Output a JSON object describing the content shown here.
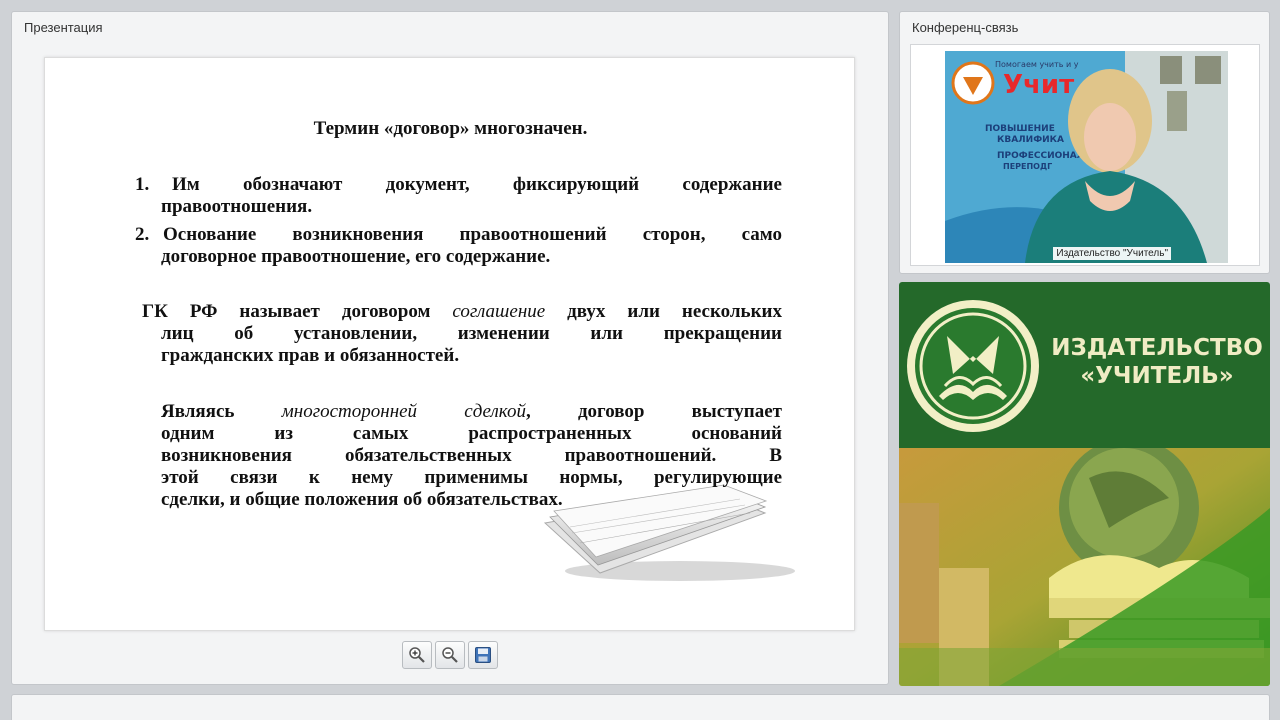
{
  "presentation": {
    "title": "Презентация",
    "slide": {
      "heading": "Термин «договор» многозначен.",
      "item1_num": "1.",
      "item1_line1": "Им обозначают документ, фиксирующий содержание",
      "item1_line2": "правоотношения.",
      "item2_num": "2.",
      "item2_line1": "Основание возникновения правоотношений сторон, само",
      "item2_line2": "договорное правоотношение, его содержание.",
      "para1_line1_a": "ГК РФ называет договором ",
      "para1_line1_em": "соглашение",
      "para1_line1_b": " двух или нескольких",
      "para1_line2": "лиц об установлении, изменении или прекращении",
      "para1_line3": "гражданских прав и обязанностей.",
      "para2_line1_a": "Являясь ",
      "para2_line1_em": "многосторонней сделкой",
      "para2_line1_b": ", договор выступает",
      "para2_line2": "одним из самых распространенных оснований",
      "para2_line3": "возникновения обязательственных правоотношений. В",
      "para2_line4": "этой связи к нему применимы нормы, регулирующие",
      "para2_line5": "сделки, и общие положения об обязательствах."
    },
    "toolbar": {
      "zoom_in_icon": "zoom-in-icon",
      "zoom_out_icon": "zoom-out-icon",
      "save_icon": "save-icon"
    }
  },
  "conference": {
    "title": "Конференц-связь",
    "video_caption": "Издательство \"Учитель\""
  },
  "brand": {
    "name_line1": "ИЗДАТЕЛЬСТВО",
    "name_line2": "«УЧИТЕЛЬ»",
    "colors": {
      "green": "#24692a",
      "cream": "#f0ecc4"
    }
  }
}
